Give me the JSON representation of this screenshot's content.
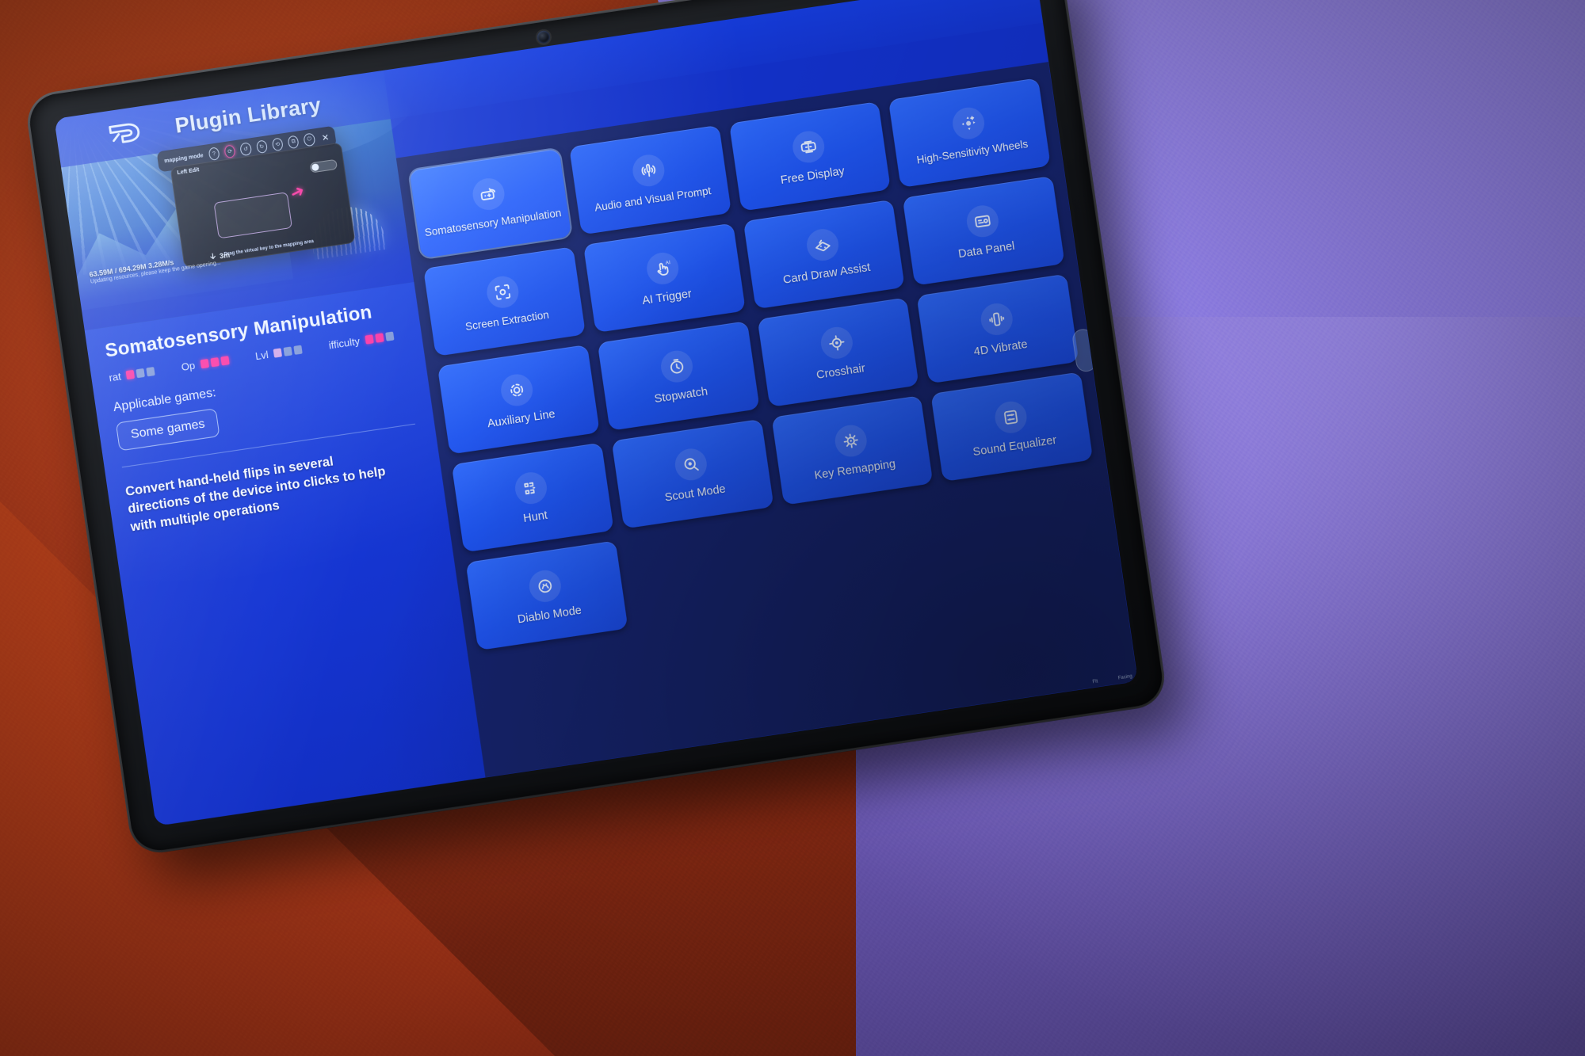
{
  "app": {
    "title": "Plugin Library",
    "logo_icon": "game-turbo-logo-icon"
  },
  "preview": {
    "toolbar_title": "mapping mode",
    "panel_title": "Left Edit",
    "hint": "Drag the virtual key to the mapping area",
    "toolbar_icons": [
      "help-icon",
      "rotate-icon",
      "undo-icon",
      "redo-icon",
      "refresh-icon",
      "duplicate-icon",
      "power-icon",
      "close-icon"
    ],
    "download_line1": "63.59M / 694.29M 3.28M/s",
    "download_line2": "Updating resources, please keep the game opening...",
    "eta": "3m",
    "tabs": [
      "Fit",
      "Facing"
    ]
  },
  "detail": {
    "plugin_title": "Somatosensory Manipulation",
    "stats": [
      {
        "label": "rat",
        "level": 1
      },
      {
        "label": "Op",
        "level": 3
      },
      {
        "label": "Lvl",
        "level": 1
      },
      {
        "label": "ifficulty",
        "level": 2
      }
    ],
    "applicable_label": "Applicable games:",
    "games_chip": "Some games",
    "description": "Convert hand-held flips in several directions of the device into clicks to help with multiple operations"
  },
  "grid": {
    "tiles": [
      {
        "label": "Somatosensory Manipulation",
        "icon": "somatosensor-icon",
        "selected": true
      },
      {
        "label": "Audio and Visual Prompt",
        "icon": "audio-visual-icon",
        "selected": false
      },
      {
        "label": "Free Display",
        "icon": "free-display-icon",
        "selected": false
      },
      {
        "label": "High-Sensitivity Wheels",
        "icon": "high-sensitivity-wheels-icon",
        "selected": false
      },
      {
        "label": "Screen Extraction",
        "icon": "screen-extraction-icon",
        "selected": false
      },
      {
        "label": "AI Trigger",
        "icon": "ai-trigger-icon",
        "selected": false
      },
      {
        "label": "Card Draw Assist",
        "icon": "card-draw-icon",
        "selected": false
      },
      {
        "label": "Data Panel",
        "icon": "data-panel-icon",
        "selected": false
      },
      {
        "label": "Auxiliary Line",
        "icon": "auxiliary-line-icon",
        "selected": false
      },
      {
        "label": "Stopwatch",
        "icon": "stopwatch-icon",
        "selected": false
      },
      {
        "label": "Crosshair",
        "icon": "crosshair-icon",
        "selected": false
      },
      {
        "label": "4D Vibrate",
        "icon": "vibrate-icon",
        "selected": false
      },
      {
        "label": "Hunt",
        "icon": "hunt-icon",
        "selected": false
      },
      {
        "label": "Scout Mode",
        "icon": "scout-mode-icon",
        "selected": false
      },
      {
        "label": "Key Remapping",
        "icon": "key-remapping-icon",
        "selected": false
      },
      {
        "label": "Sound Equalizer",
        "icon": "sound-equalizer-icon",
        "selected": false
      },
      {
        "label": "Diablo Mode",
        "icon": "diablo-mode-icon",
        "selected": false
      }
    ]
  },
  "colors": {
    "accent_pink": "#ff2fa0",
    "tile_blue": "#2f6bff",
    "panel_blue": "#16246e",
    "app_blue": "#1333d2"
  }
}
